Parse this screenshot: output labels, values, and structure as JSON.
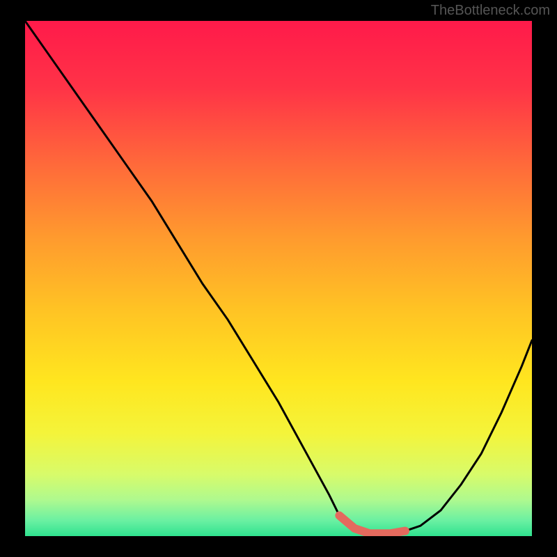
{
  "attribution": "TheBottleneck.com",
  "chart_data": {
    "type": "line",
    "title": "",
    "xlabel": "",
    "ylabel": "",
    "xlim": [
      0,
      100
    ],
    "ylim": [
      0,
      100
    ],
    "series": [
      {
        "name": "bottleneck-curve",
        "x": [
          0,
          5,
          10,
          15,
          20,
          25,
          30,
          35,
          40,
          45,
          50,
          55,
          60,
          62,
          65,
          68,
          72,
          75,
          78,
          82,
          86,
          90,
          94,
          98,
          100
        ],
        "values": [
          100,
          93,
          86,
          79,
          72,
          65,
          57,
          49,
          42,
          34,
          26,
          17,
          8,
          4,
          1.5,
          0.5,
          0.5,
          1,
          2,
          5,
          10,
          16,
          24,
          33,
          38
        ]
      }
    ],
    "highlight": {
      "x_start": 62,
      "x_end": 75,
      "y": 0.5,
      "color": "#e46a5e"
    },
    "background_gradient": {
      "stops": [
        {
          "offset": 0,
          "color": "#ff1a4a"
        },
        {
          "offset": 0.13,
          "color": "#ff3347"
        },
        {
          "offset": 0.28,
          "color": "#ff6a3a"
        },
        {
          "offset": 0.42,
          "color": "#ff9a2e"
        },
        {
          "offset": 0.56,
          "color": "#ffc324"
        },
        {
          "offset": 0.7,
          "color": "#ffe61f"
        },
        {
          "offset": 0.8,
          "color": "#f4f43a"
        },
        {
          "offset": 0.88,
          "color": "#d8fb6a"
        },
        {
          "offset": 0.93,
          "color": "#aef98f"
        },
        {
          "offset": 0.97,
          "color": "#6af0a2"
        },
        {
          "offset": 1.0,
          "color": "#2fe28f"
        }
      ]
    }
  }
}
